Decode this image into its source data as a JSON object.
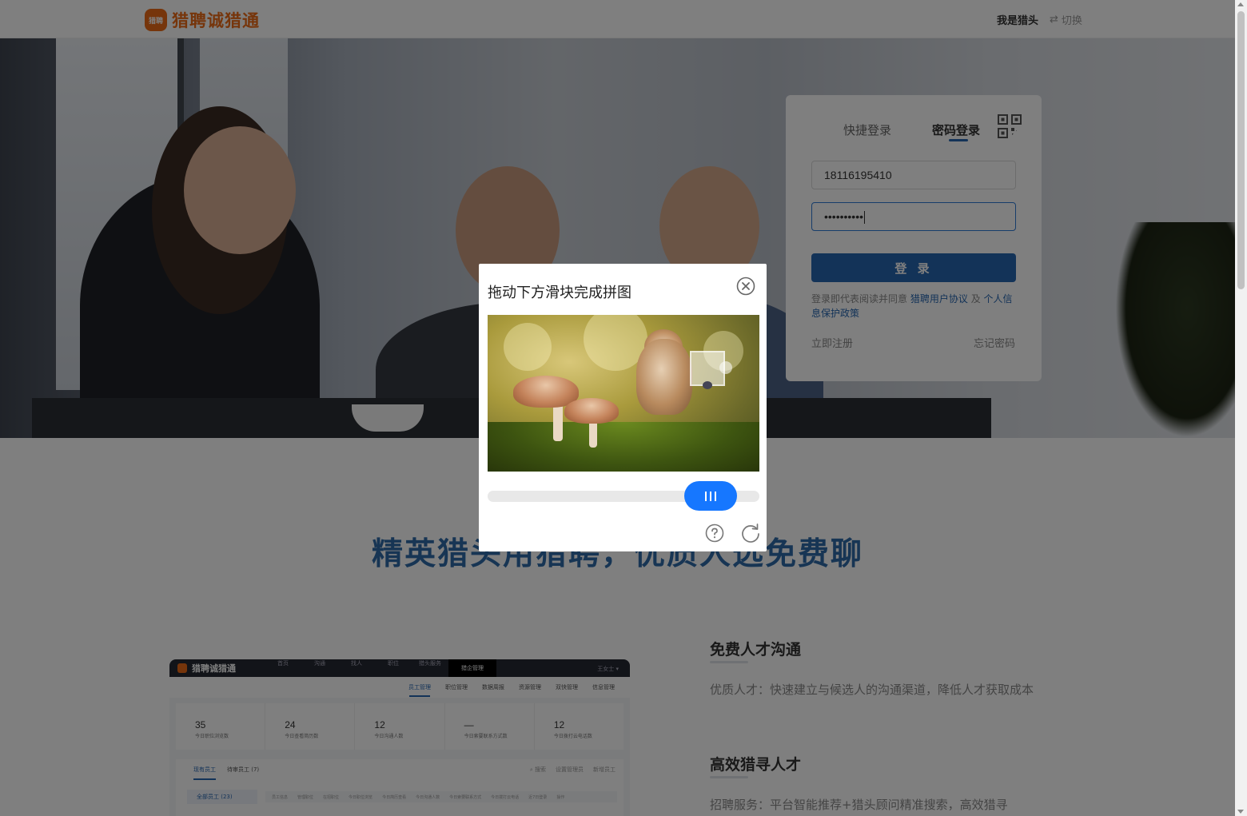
{
  "header": {
    "logo_badge": "猎聘",
    "logo_text": "猎聘诚猎通",
    "role_label": "我是猎头",
    "switch_label": "切换",
    "switch_icon": "swap-icon"
  },
  "login": {
    "tab_quick": "快捷登录",
    "tab_password": "密码登录",
    "qr_icon": "qr-code-icon",
    "phone_value": "18116195410",
    "password_value": "••••••••••",
    "login_button": "登 录",
    "agree_prefix": "登录即代表阅读并同意",
    "agree_link1": "猎聘用户协议",
    "agree_and": "及",
    "agree_link2": "个人信息保护政策",
    "register": "立即注册",
    "forgot": "忘记密码",
    "accent_color": "#2766b0"
  },
  "slogan": "精英猎头用猎聘，优质人选免费聊",
  "preview": {
    "logo_text": "猎聘诚猎通",
    "nav": [
      "首页",
      "沟通",
      "找人",
      "职位",
      "猎头服务"
    ],
    "nav_active": "猎企管理",
    "user": "王女士 ▾",
    "subnav": [
      "员工管理",
      "职位管理",
      "数据周报",
      "资源管理",
      "双快管理",
      "信息管理"
    ],
    "stats": [
      {
        "num": "35",
        "label": "今日职位浏览数"
      },
      {
        "num": "24",
        "label": "今日查看简历数"
      },
      {
        "num": "12",
        "label": "今日沟通人数"
      },
      {
        "num": "—",
        "label": "今日索要联系方式数"
      },
      {
        "num": "12",
        "label": "今日拨打云电话数"
      }
    ],
    "tabs": [
      "现有员工",
      "待审员工 (7)"
    ],
    "search": [
      "搜索",
      "设置管理员",
      "新增员工"
    ],
    "side": "全部员工 (23)",
    "columns": [
      "员工信息",
      "管理职位",
      "在招职位",
      "今日职位浏览",
      "今日简历查看",
      "今日沟通人数",
      "今日索要联系方式",
      "今日拨打云电话",
      "近7日登录",
      "操作"
    ]
  },
  "features": [
    {
      "title": "免费人才沟通",
      "desc": "优质人才：快速建立与候选人的沟通渠道，降低人才获取成本"
    },
    {
      "title": "高效猎寻人才",
      "desc": "招聘服务：平台智能推荐+猎头顾问精准搜索，高效猎寻"
    }
  ],
  "captcha": {
    "title": "拖动下方滑块完成拼图",
    "close_icon": "close-circle-icon",
    "help_icon": "help-circle-icon",
    "refresh_icon": "refresh-icon",
    "slider_color": "#1677ff"
  }
}
